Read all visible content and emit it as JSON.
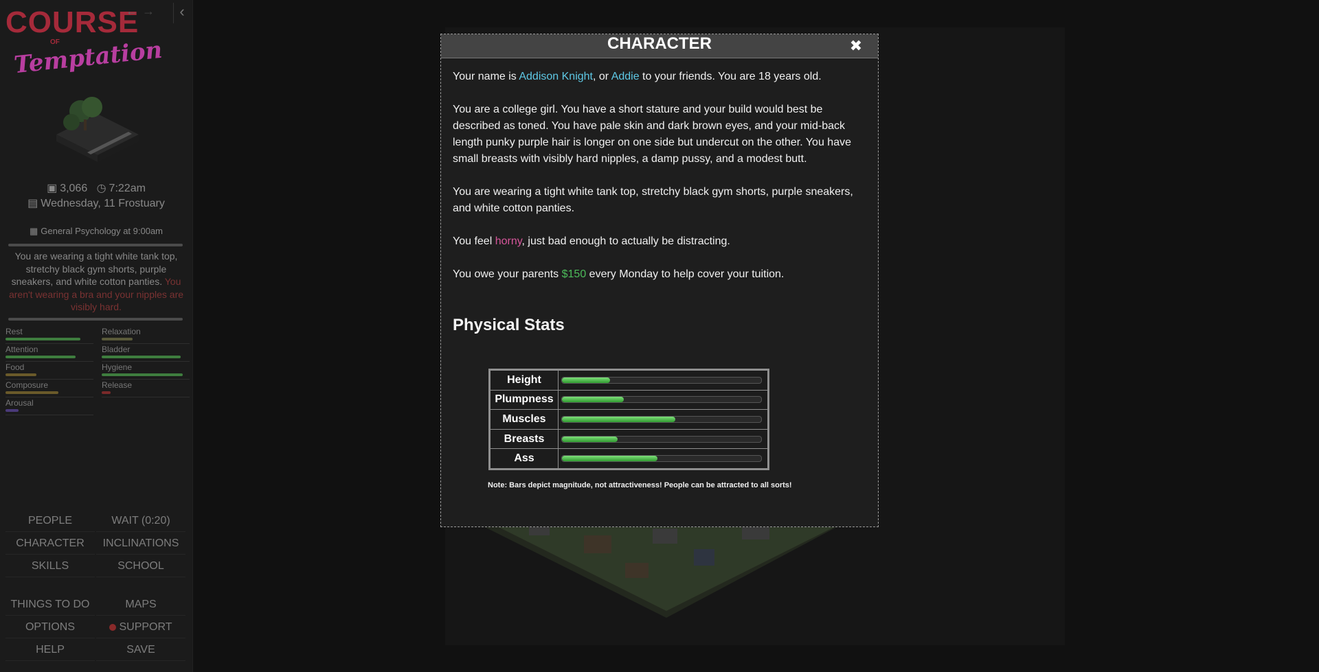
{
  "sidebar": {
    "logo": {
      "line1": "COURSE",
      "line2": "OF",
      "line3": "Temptation"
    },
    "money": "3,066",
    "time": "7:22am",
    "date": "Wednesday, 11 Frostuary",
    "schedule": "General Psychology at 9:00am",
    "outfit_text": "You are wearing a tight white tank top, stretchy black gym shorts, purple sneakers, and white cotton panties.",
    "outfit_warning": "You aren't wearing a bra and your nipples are visibly hard.",
    "stats": [
      {
        "label": "Rest",
        "value": 0.85,
        "color": "#3e7d3e"
      },
      {
        "label": "Relaxation",
        "value": 0.35,
        "color": "#5a5a3a"
      },
      {
        "label": "Attention",
        "value": 0.8,
        "color": "#3e7d3e"
      },
      {
        "label": "Bladder",
        "value": 0.9,
        "color": "#3e7d3e"
      },
      {
        "label": "Food",
        "value": 0.35,
        "color": "#6a5a2a"
      },
      {
        "label": "Hygiene",
        "value": 0.92,
        "color": "#3e7d3e"
      },
      {
        "label": "Composure",
        "value": 0.6,
        "color": "#6a5a2a"
      },
      {
        "label": "Release",
        "value": 0.1,
        "color": "#7a2a2a"
      },
      {
        "label": "Arousal",
        "value": 0.15,
        "color": "#4a3a7a"
      }
    ],
    "buttons": {
      "people": "PEOPLE",
      "wait": "WAIT (0:20)",
      "character": "CHARACTER",
      "inclinations": "INCLINATIONS",
      "skills": "SKILLS",
      "school": "SCHOOL",
      "things_to_do": "THINGS TO DO",
      "maps": "MAPS",
      "options": "OPTIONS",
      "support": "SUPPORT",
      "help": "HELP",
      "save": "SAVE"
    }
  },
  "modal": {
    "title": "CHARACTER",
    "close_icon": "close-icon",
    "name_intro": "Your name is ",
    "full_name": "Addison Knight",
    "name_mid": ", or ",
    "nickname": "Addie",
    "name_end": " to your friends. You are 18 years old.",
    "body_desc": "You are a college girl. You have a short stature and your build would best be described as toned. You have pale skin and dark brown eyes, and your mid-back length punky purple hair is longer on one side but undercut on the other. You have small breasts with visibly hard nipples, a damp pussy, and a modest butt.",
    "wearing": "You are wearing a tight white tank top, stretchy black gym shorts, purple sneakers, and white cotton panties.",
    "feel_start": "You feel ",
    "feel_word": "horny",
    "feel_end": ", just bad enough to actually be distracting.",
    "owe_start": "You owe your parents ",
    "owe_amount": "$150",
    "owe_end": " every Monday to help cover your tuition.",
    "stats_heading": "Physical Stats",
    "physical_stats": [
      {
        "label": "Height",
        "value": 0.24
      },
      {
        "label": "Plumpness",
        "value": 0.31
      },
      {
        "label": "Muscles",
        "value": 0.57
      },
      {
        "label": "Breasts",
        "value": 0.28
      },
      {
        "label": "Ass",
        "value": 0.48
      }
    ],
    "note": "Note: Bars depict magnitude, not attractiveness! People can be attracted to all sorts!"
  },
  "colors": {
    "name_accent": "#5ec8e5",
    "mood_accent": "#d6559a",
    "money_accent": "#4cbb5a",
    "bar_fill": "#4caf4c"
  }
}
